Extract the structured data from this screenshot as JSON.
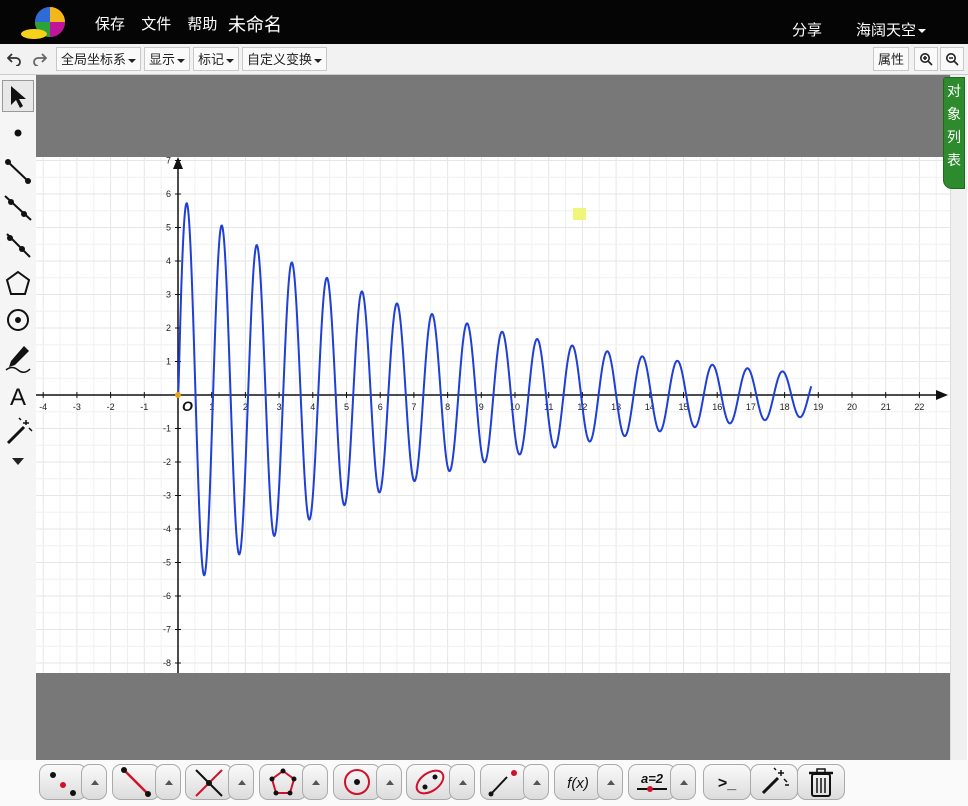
{
  "topbar": {
    "menu": [
      "保存",
      "文件",
      "帮助"
    ],
    "title": "未命名",
    "share": "分享",
    "user": "海阔天空"
  },
  "toolbar": {
    "undo_icon": "undo-icon",
    "redo_icon": "redo-icon",
    "coord_system": "全局坐标系",
    "display": "显示",
    "mark": "标记",
    "custom_transform": "自定义变换",
    "properties": "属性",
    "zoom_in_icon": "zoom-in-icon",
    "zoom_out_icon": "zoom-out-icon"
  },
  "left_tools": [
    "select-arrow-icon",
    "point-icon",
    "segment-icon",
    "ray-icon",
    "line-icon",
    "polygon-icon",
    "circle-icon",
    "pen-icon",
    "text-icon",
    "magic-wand-icon",
    "more-icon"
  ],
  "object_list_label": "对象列表",
  "graph": {
    "origin_label": "O",
    "x_ticks": [
      "-4",
      "-3",
      "-2",
      "-1",
      "1",
      "2",
      "3",
      "4",
      "5",
      "6",
      "7",
      "8",
      "9",
      "10",
      "11",
      "12",
      "13",
      "14",
      "15",
      "16",
      "17",
      "18",
      "19",
      "20",
      "21",
      "22",
      "2"
    ],
    "y_ticks": [
      "7",
      "6",
      "5",
      "4",
      "3",
      "2",
      "1",
      "-1",
      "-2",
      "-3",
      "-4",
      "-5",
      "-6",
      "-7",
      "-8"
    ],
    "curve_color": "#1f3fd6",
    "curve_desc": "damped sine oscillation",
    "curve_peak": 5.9,
    "curve_period": 1.04,
    "curve_x_range": [
      0,
      18.8
    ]
  },
  "bottom_tools": [
    "point-tools",
    "line-tools",
    "intersection-tools",
    "polygon-tools",
    "circle-tools",
    "conic-tools",
    "transform-tools",
    "function-tool",
    "parameter-tool",
    "command-tool",
    "magic-tool",
    "trash-icon"
  ],
  "bottom_labels": {
    "function": "f(x)",
    "parameter": "a=2",
    "command": ">_"
  }
}
